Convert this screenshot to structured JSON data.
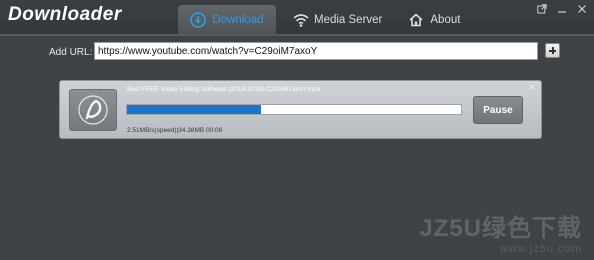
{
  "app": {
    "title": "Downloader"
  },
  "tabs": [
    {
      "label": "Download",
      "icon": "download-icon",
      "active": true
    },
    {
      "label": "Media Server",
      "icon": "wifi-icon",
      "active": false
    },
    {
      "label": "About",
      "icon": "home-icon",
      "active": false
    }
  ],
  "window_controls": [
    "external-link-icon",
    "minimize-icon",
    "close-icon"
  ],
  "url_bar": {
    "label": "Add URL:",
    "value": "https://www.youtube.com/watch?v=C29oiM7axoY",
    "add_button_icon": "plus-icon"
  },
  "download_item": {
    "file_name": "Best FREE Video Editing Software (2018-2019)-C29oiM7axoY.mp4",
    "status": "2.51MB/s(speed)|34.38MB 00:08",
    "progress": 0.4,
    "pause_label": "Pause",
    "thumb_icon": "app-logo-icon"
  },
  "watermark": {
    "main": "JZ5U绿色下载",
    "url": "www.jz5u.com"
  },
  "colors": {
    "accent": "#2f9fe0",
    "progress": "#1f73c9",
    "background": "#3f4246"
  }
}
